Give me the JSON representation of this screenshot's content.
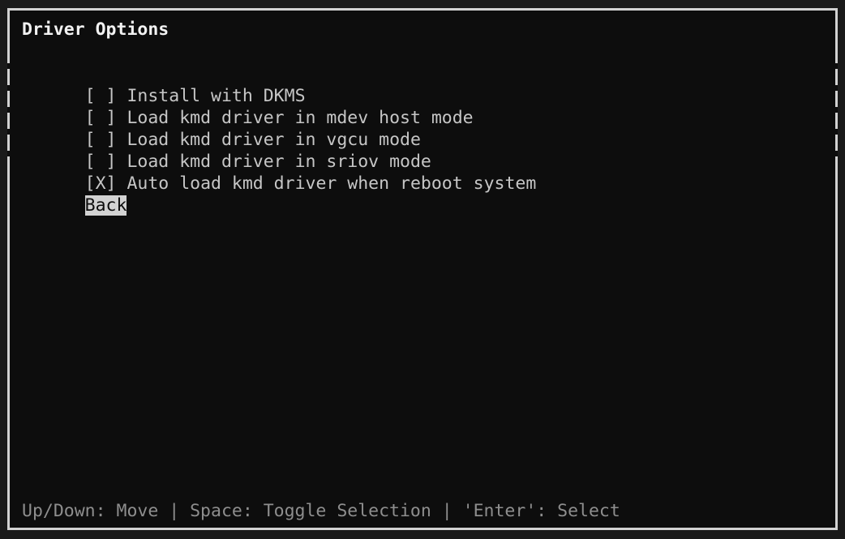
{
  "screen": {
    "title": "Driver Options",
    "background_color": "#0d0d0d",
    "border_color": "#d2d2d2",
    "text_color": "#c6c6c6",
    "title_color": "#f2f2f2",
    "highlight_bg": "#d2d2d2",
    "highlight_fg": "#0d0d0d",
    "status_color": "#8e8e8e"
  },
  "menu": {
    "items": [
      {
        "checkbox": "[ ]",
        "label": "Install with DKMS",
        "checked": false,
        "selected": false
      },
      {
        "checkbox": "[ ]",
        "label": "Load kmd driver in mdev host mode",
        "checked": false,
        "selected": false
      },
      {
        "checkbox": "[ ]",
        "label": "Load kmd driver in vgcu mode",
        "checked": false,
        "selected": false
      },
      {
        "checkbox": "[ ]",
        "label": "Load kmd driver in sriov mode",
        "checked": false,
        "selected": false
      },
      {
        "checkbox": "[X]",
        "label": "Auto load kmd driver when reboot system",
        "checked": true,
        "selected": false
      }
    ],
    "back_label": "Back"
  },
  "status": {
    "hint": "Up/Down: Move | Space: Toggle Selection | 'Enter': Select"
  }
}
